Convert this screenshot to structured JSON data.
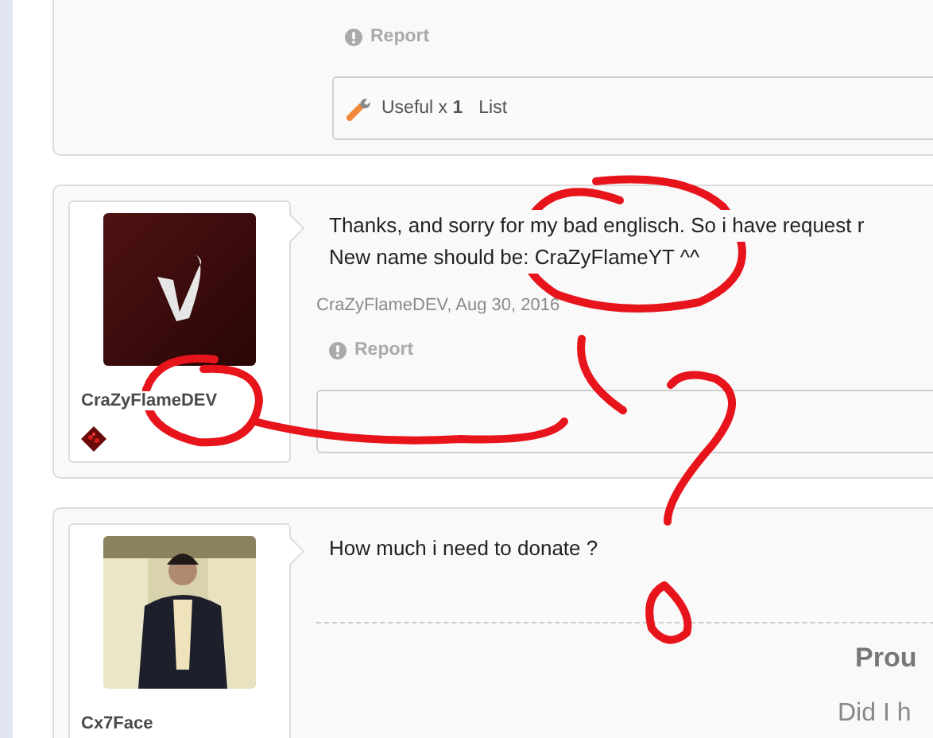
{
  "posts": [
    {
      "kind": "tail",
      "report": "Report",
      "likes": {
        "text": "Useful x **1**",
        "link": "List"
      }
    },
    {
      "kind": "full",
      "user": {
        "name": "CraZyFlameDEV",
        "badge": true
      },
      "message": [
        "Thanks, and sorry for my bad englisch. So i have request r",
        "New name should be: CraZyFlameYT ^^"
      ],
      "meta": "CraZyFlameDEV, Aug 30, 2016",
      "report": "Report"
    },
    {
      "kind": "head",
      "user": {
        "name": "Cx7Face",
        "badge": false
      },
      "message": [
        "How much i need to donate ?"
      ],
      "signature": {
        "title": "Prou",
        "line": "Did I h"
      }
    }
  ]
}
